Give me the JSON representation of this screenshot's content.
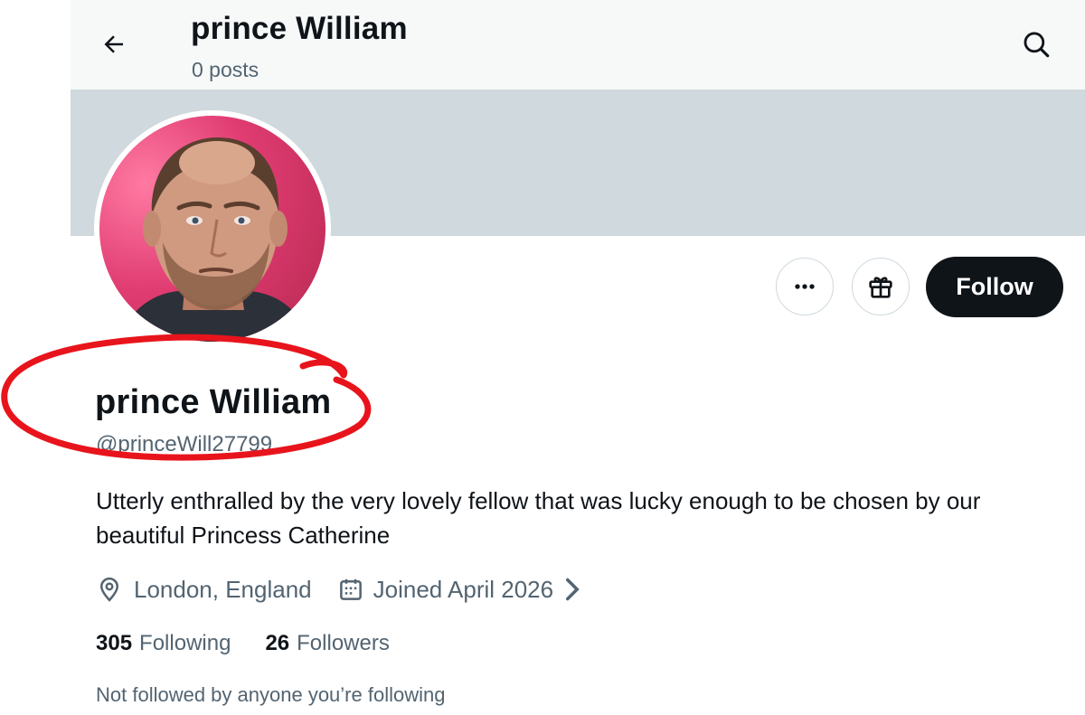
{
  "header": {
    "title": "prince William",
    "post_count": "0 posts",
    "back_icon": "arrow-left-icon",
    "search_icon": "search-icon"
  },
  "profile": {
    "display_name": "prince William",
    "handle": "@princeWill27799",
    "bio": "Utterly enthralled by the very lovely fellow that was lucky enough to be chosen by our beautiful Princess Catherine",
    "location": "London, England",
    "joined": "Joined April 2026",
    "following_count": "305",
    "following_label": "Following",
    "followers_count": "26",
    "followers_label": "Followers",
    "not_followed_text": "Not followed by anyone you’re following"
  },
  "actions": {
    "more_icon": "more-horizontal-icon",
    "gift_icon": "gift-icon",
    "follow_label": "Follow"
  },
  "colors": {
    "banner": "#cfd9de",
    "header_bg": "#f7f9f9",
    "follow_button": "#0f1419",
    "secondary_text": "#536471",
    "annotation": "#e8141c"
  }
}
